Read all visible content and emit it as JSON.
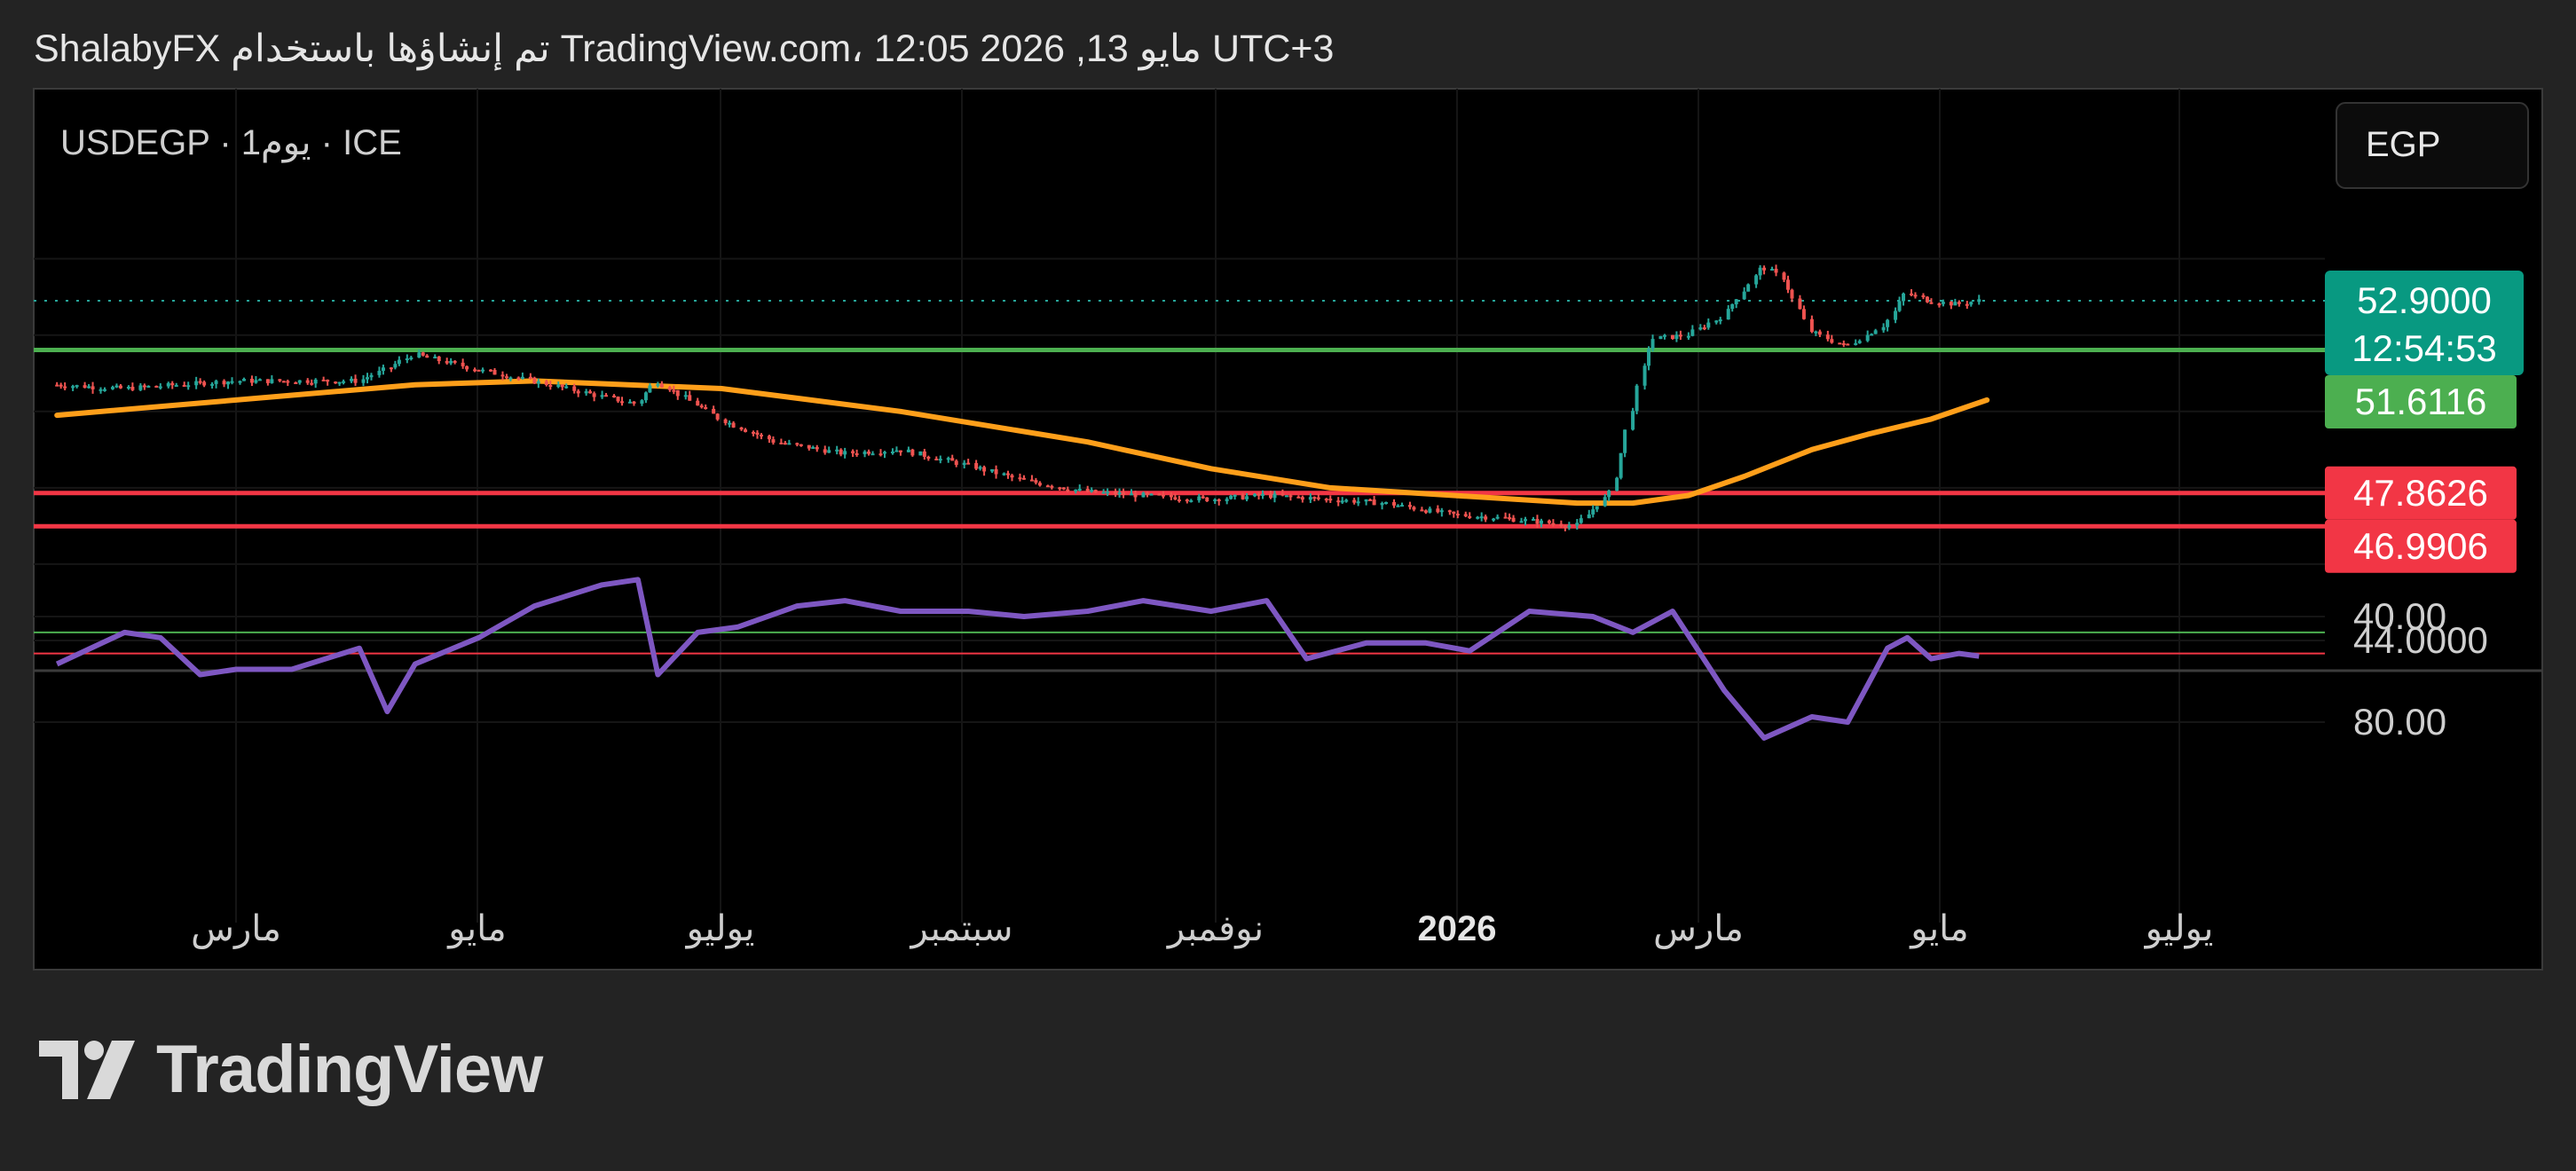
{
  "header": {
    "caption": "ShalabyFX تم إنشاؤها باستخدام TradingView.com، 12:05 2026 ,13 مايو UTC+3"
  },
  "legend": {
    "symbol": "USDEGP · 1يوم · ICE"
  },
  "currency_button": {
    "label": "EGP"
  },
  "brand": {
    "name": "TradingView",
    "icon": "tradingview-logo-icon"
  },
  "colors": {
    "background": "#000000",
    "frame": "#232323",
    "up_candle": "#26a69a",
    "down_candle": "#ef5350",
    "moving_average": "#ff9f1a",
    "rsi": "#7e57c2",
    "support_line": "#4caf50",
    "resistance_line": "#f23645",
    "current_price_bg": "#089981"
  },
  "chart_data": [
    {
      "type": "candlestick",
      "title": "USDEGP · 1يوم · ICE",
      "ylim": [
        44.0,
        54.5
      ],
      "y_tick_labels": [
        "44.0000"
      ],
      "x_tick_labels": [
        "مارس",
        "مايو",
        "يوليو",
        "سبتمبر",
        "نوفمبر",
        "2026",
        "مارس",
        "مايو",
        "يوليو"
      ],
      "grid": true,
      "current_price": {
        "value": "52.9000",
        "countdown": "12:54:53"
      },
      "horizontal_lines": [
        {
          "value": 51.6116,
          "label": "51.6116",
          "color": "#4caf50"
        },
        {
          "value": 47.8626,
          "label": "47.8626",
          "color": "#f23645"
        },
        {
          "value": 46.9906,
          "label": "46.9906",
          "color": "#f23645"
        }
      ],
      "series": [
        {
          "kind": "price_close",
          "x": [
            "2025-01-15",
            "2025-02-01",
            "2025-02-15",
            "2025-03-01",
            "2025-03-15",
            "2025-04-01",
            "2025-04-08",
            "2025-04-15",
            "2025-05-01",
            "2025-05-15",
            "2025-06-01",
            "2025-06-10",
            "2025-06-15",
            "2025-06-20",
            "2025-07-01",
            "2025-07-15",
            "2025-08-01",
            "2025-08-15",
            "2025-09-01",
            "2025-09-15",
            "2025-10-01",
            "2025-10-15",
            "2025-11-01",
            "2025-11-15",
            "2025-12-01",
            "2025-12-15",
            "2026-01-01",
            "2026-01-15",
            "2026-02-01",
            "2026-02-10",
            "2026-02-15",
            "2026-02-20",
            "2026-03-01",
            "2026-03-10",
            "2026-03-20",
            "2026-03-25",
            "2026-04-01",
            "2026-04-10",
            "2026-04-20",
            "2026-04-25",
            "2026-05-01",
            "2026-05-08",
            "2026-05-13"
          ],
          "values": [
            50.7,
            50.6,
            50.7,
            50.8,
            50.8,
            50.8,
            51.1,
            51.5,
            51.1,
            50.8,
            50.4,
            50.2,
            50.8,
            50.5,
            49.8,
            49.2,
            48.9,
            49.0,
            48.6,
            48.2,
            47.9,
            47.8,
            47.7,
            47.8,
            47.7,
            47.6,
            47.3,
            47.2,
            47.0,
            47.9,
            50.0,
            51.9,
            52.0,
            52.5,
            53.8,
            53.5,
            52.1,
            51.7,
            52.3,
            53.1,
            52.9,
            52.8,
            52.9
          ]
        },
        {
          "kind": "moving_average",
          "x": [
            "2025-01-15",
            "2025-03-01",
            "2025-04-15",
            "2025-05-15",
            "2025-07-01",
            "2025-08-15",
            "2025-10-01",
            "2025-11-01",
            "2025-12-01",
            "2026-01-01",
            "2026-02-01",
            "2026-02-15",
            "2026-03-01",
            "2026-03-15",
            "2026-04-01",
            "2026-04-15",
            "2026-05-01",
            "2026-05-15"
          ],
          "values": [
            49.9,
            50.3,
            50.7,
            50.8,
            50.6,
            50.0,
            49.2,
            48.5,
            48.0,
            47.8,
            47.6,
            47.6,
            47.8,
            48.3,
            49.0,
            49.4,
            49.8,
            50.3
          ]
        }
      ]
    },
    {
      "type": "line",
      "title": "",
      "ylim": [
        22,
        100
      ],
      "y_tick_labels": [
        "80.00",
        "40.00"
      ],
      "levels": [
        {
          "value": 54,
          "color": "#f23645"
        },
        {
          "value": 46,
          "color": "#4caf50"
        }
      ],
      "series": [
        {
          "kind": "rsi",
          "x": [
            "2025-01-15",
            "2025-02-01",
            "2025-02-10",
            "2025-02-20",
            "2025-03-01",
            "2025-03-15",
            "2025-04-01",
            "2025-04-08",
            "2025-04-15",
            "2025-05-01",
            "2025-05-15",
            "2025-06-01",
            "2025-06-10",
            "2025-06-15",
            "2025-06-25",
            "2025-07-05",
            "2025-07-20",
            "2025-08-01",
            "2025-08-15",
            "2025-09-01",
            "2025-09-15",
            "2025-10-01",
            "2025-10-15",
            "2025-11-01",
            "2025-11-15",
            "2025-11-25",
            "2025-12-10",
            "2025-12-25",
            "2026-01-05",
            "2026-01-20",
            "2026-02-05",
            "2026-02-15",
            "2026-02-25",
            "2026-03-10",
            "2026-03-20",
            "2026-04-01",
            "2026-04-10",
            "2026-04-20",
            "2026-04-25",
            "2026-05-01",
            "2026-05-08",
            "2026-05-13"
          ],
          "values": [
            58,
            46,
            48,
            62,
            60,
            60,
            52,
            76,
            58,
            48,
            36,
            28,
            26,
            62,
            46,
            44,
            36,
            34,
            38,
            38,
            40,
            38,
            34,
            38,
            34,
            56,
            50,
            50,
            53,
            38,
            40,
            46,
            38,
            68,
            86,
            78,
            80,
            52,
            48,
            56,
            54,
            55
          ]
        }
      ]
    }
  ]
}
